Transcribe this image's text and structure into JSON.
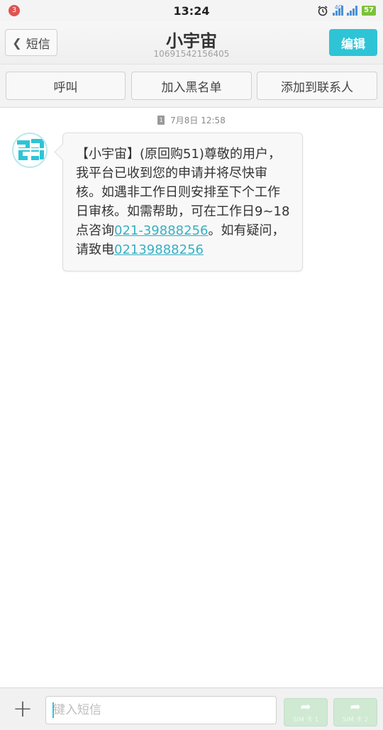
{
  "status_bar": {
    "notification_count": "3",
    "time": "13:24",
    "network_label": "4G",
    "battery": "57"
  },
  "header": {
    "back_label": "短信",
    "contact_name": "小宇宙",
    "contact_number": "10691542156405",
    "edit_label": "编辑"
  },
  "actions": {
    "call": "呼叫",
    "blacklist": "加入黑名单",
    "add_contact": "添加到联系人"
  },
  "conversation": {
    "timestamp": "7月8日 12:58",
    "message": {
      "text_1": "【小宇宙】(原回购51)尊敬的用户，我平台已收到您的申请并将尽快审核。如遇非工作日则安排至下个工作日审核。如需帮助，可在工作日9~18点咨询",
      "link_1": "021-39888256",
      "text_2": "。如有疑问，请致电",
      "link_2": "02139888256"
    }
  },
  "composer": {
    "placeholder": "键入短信",
    "send_sim1": "SIM 卡 1",
    "send_sim2": "SIM 卡 2"
  },
  "colors": {
    "accent": "#2ec4d6",
    "link": "#36b0c4",
    "send_disabled": "#cfe9d3"
  },
  "icons": [
    "back-chevron-icon",
    "alarm-icon",
    "signal-icon",
    "battery-icon",
    "sms-icon",
    "plus-icon",
    "send-icon"
  ]
}
